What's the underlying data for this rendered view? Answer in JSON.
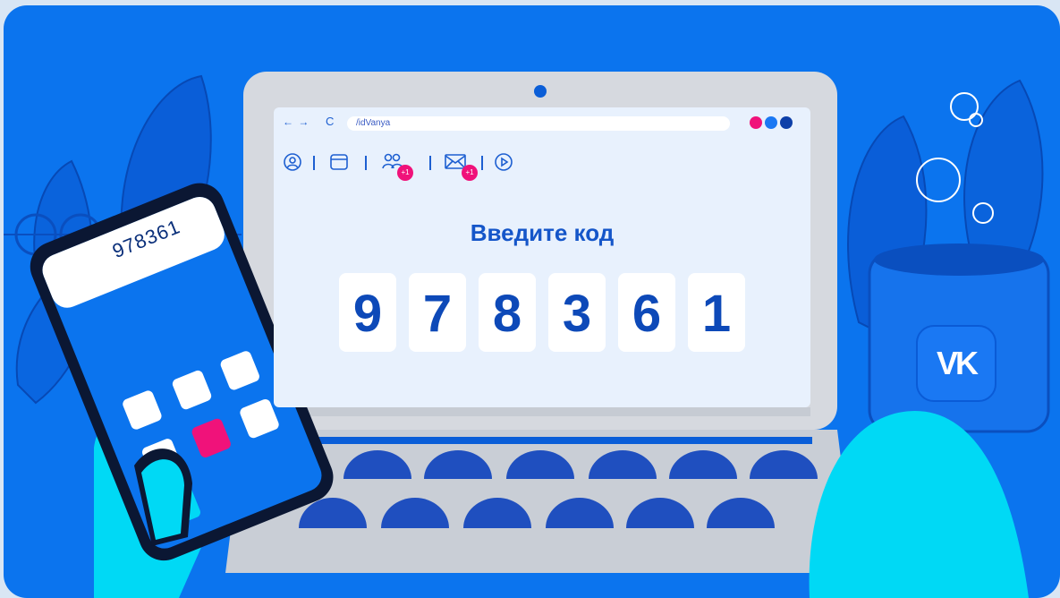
{
  "browser": {
    "url": "/idVanya",
    "nav_arrows": "← →",
    "reload": "C"
  },
  "window_dots": [
    "#f0127a",
    "#1a78f3",
    "#0d3fa8"
  ],
  "toolbar": {
    "friends_badge": "+1",
    "messages_badge": "+1"
  },
  "prompt": {
    "title": "Введите код",
    "digits": [
      "9",
      "7",
      "8",
      "3",
      "6",
      "1"
    ]
  },
  "phone": {
    "code": "978361"
  },
  "logo": {
    "text": "VK"
  },
  "colors": {
    "background": "#0b74ee",
    "accent_pink": "#f0127a",
    "accent_cyan": "#00d9f5",
    "dark_blue": "#0d49b8"
  }
}
